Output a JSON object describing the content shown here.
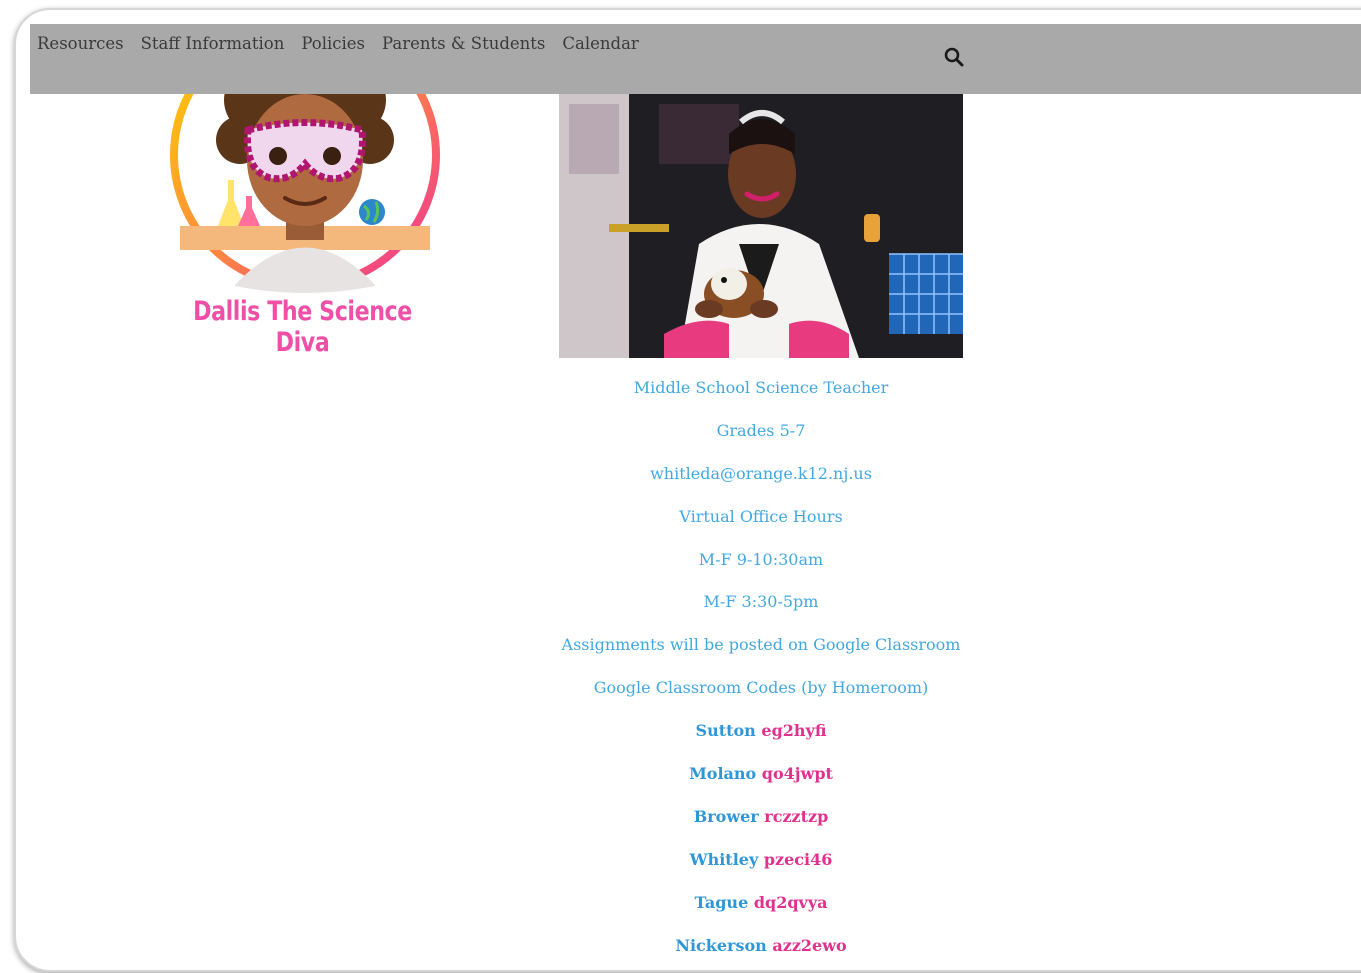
{
  "nav": {
    "items": [
      "Resources",
      "Staff Information",
      "Policies",
      "Parents & Students",
      "Calendar"
    ],
    "search_icon": "search-icon"
  },
  "logo": {
    "text": "Dallis The Science Diva",
    "icon": "cartoon-scientist-avatar"
  },
  "photo": {
    "icon": "teacher-photo"
  },
  "info": {
    "title": "Middle School Science Teacher",
    "grades": "Grades 5-7",
    "email": "whitleda@orange.k12.nj.us",
    "office_hours_label": "Virtual Office Hours",
    "hours_1": "M-F 9-10:30am",
    "hours_2": "M-F 3:30-5pm",
    "assignments_note": "Assignments will be posted on Google Classroom",
    "codes_label": "Google Classroom Codes (by Homeroom)"
  },
  "homerooms": [
    {
      "name": "Sutton",
      "code": "eg2hyfi"
    },
    {
      "name": "Molano",
      "code": "qo4jwpt"
    },
    {
      "name": "Brower",
      "code": "rczztzp"
    },
    {
      "name": "Whitley",
      "code": "pzeci46"
    },
    {
      "name": "Tague",
      "code": "dq2qvya"
    },
    {
      "name": "Nickerson",
      "code": "azz2ewo"
    }
  ],
  "colors": {
    "nav_bg": "#a9a9a9",
    "text_blue": "#43a8e0",
    "code_pink": "#e0318f",
    "brand_pink": "#ef4fa6"
  }
}
